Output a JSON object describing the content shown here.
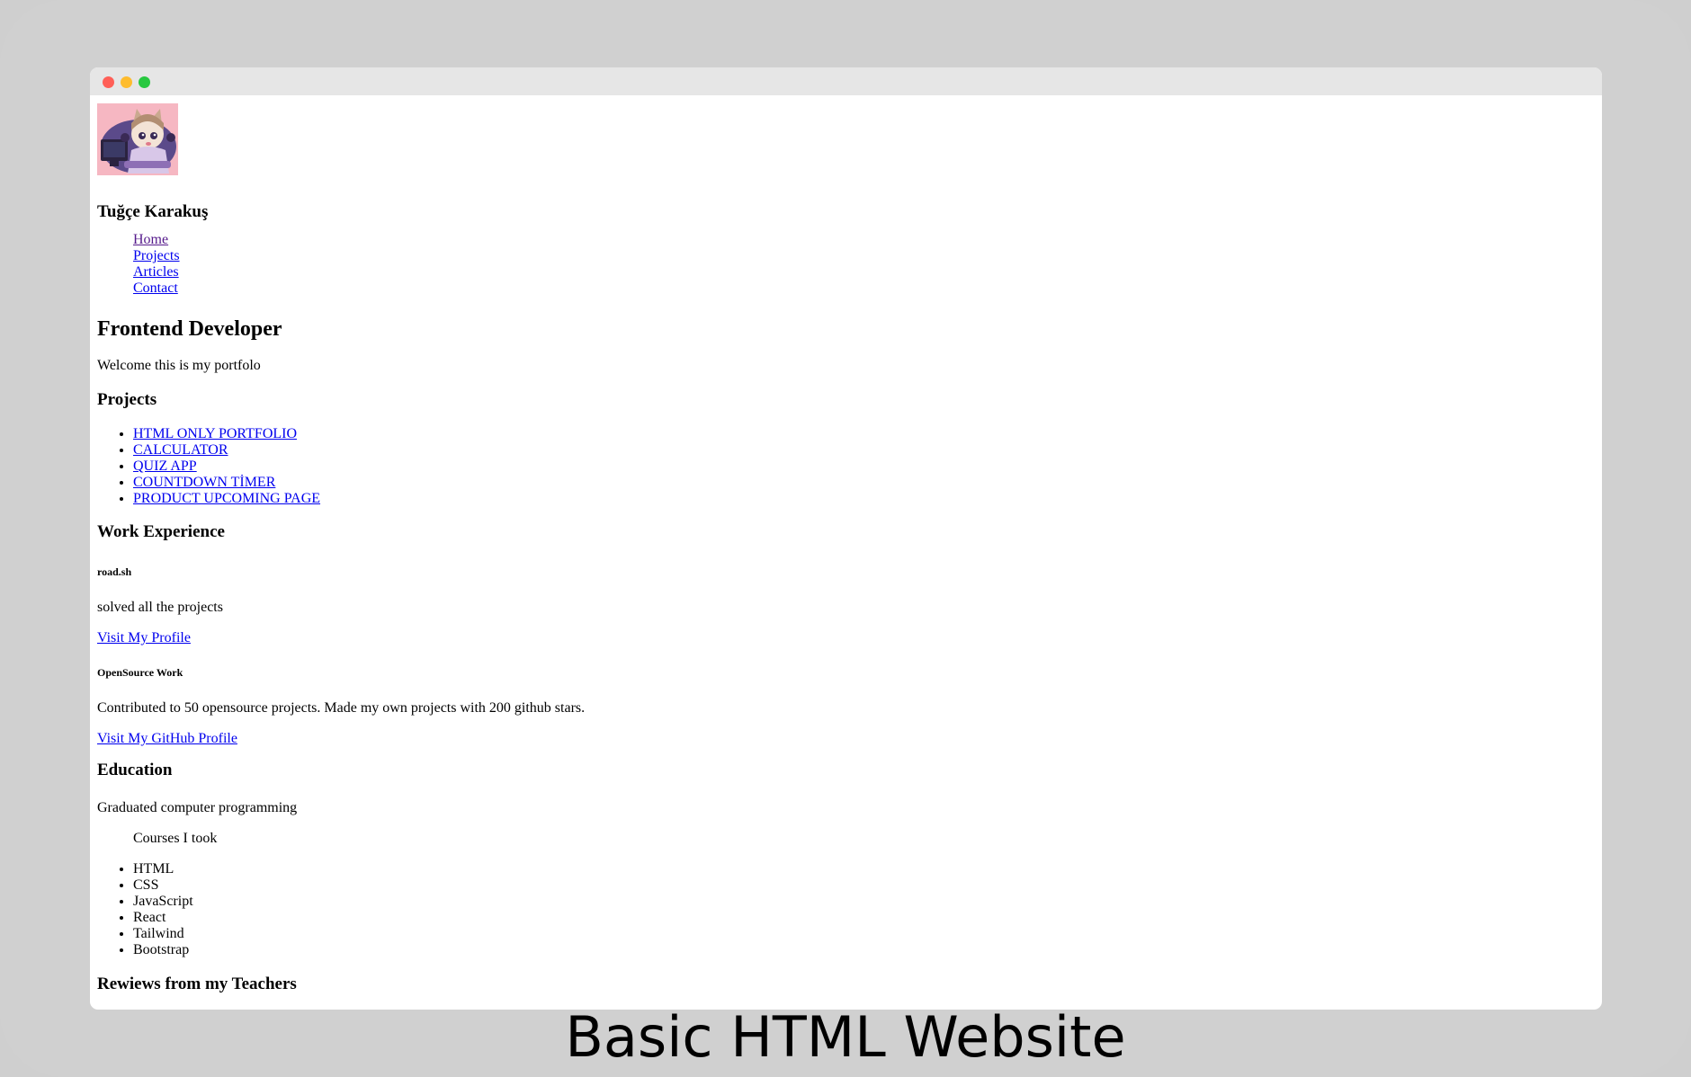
{
  "window": {
    "controls": [
      "close",
      "minimize",
      "maximize"
    ]
  },
  "header": {
    "avatar_icon": "anime-cat-girl-at-computer-avatar",
    "name": "Tuğçe Karakuş",
    "nav": [
      {
        "label": "Home"
      },
      {
        "label": "Projects"
      },
      {
        "label": "Articles"
      },
      {
        "label": "Contact"
      }
    ]
  },
  "intro": {
    "title": "Frontend Developer",
    "welcome": "Welcome this is my portfolo"
  },
  "projects": {
    "title": "Projects",
    "items": [
      {
        "label": "HTML ONLY PORTFOLIO"
      },
      {
        "label": "CALCULATOR"
      },
      {
        "label": "QUIZ APP"
      },
      {
        "label": "COUNTDOWN TİMER"
      },
      {
        "label": "PRODUCT UPCOMING PAGE"
      }
    ]
  },
  "work": {
    "title": "Work Experience",
    "roadmap": {
      "title": "road.sh",
      "text": "solved all the projects",
      "link": "Visit My Profile"
    },
    "opensource": {
      "title": "OpenSource Work",
      "text": "Contributed to 50 opensource projects. Made my own projects with 200 github stars.",
      "link": "Visit My GitHub Profile"
    }
  },
  "education": {
    "title": "Education",
    "text": "Graduated computer programming",
    "courses_label": "Courses I took",
    "courses": [
      "HTML",
      "CSS",
      "JavaScript",
      "React",
      "Tailwind",
      "Bootstrap"
    ]
  },
  "reviews": {
    "title": "Rewiews from my Teachers"
  },
  "caption": "Basic HTML Website",
  "colors": {
    "link": "#0000ee",
    "visited_link": "#551a8b",
    "avatar_bg": "#f6b7c2",
    "titlebar": "#e6e6e6",
    "outer_frame": "#d0d0d0"
  }
}
